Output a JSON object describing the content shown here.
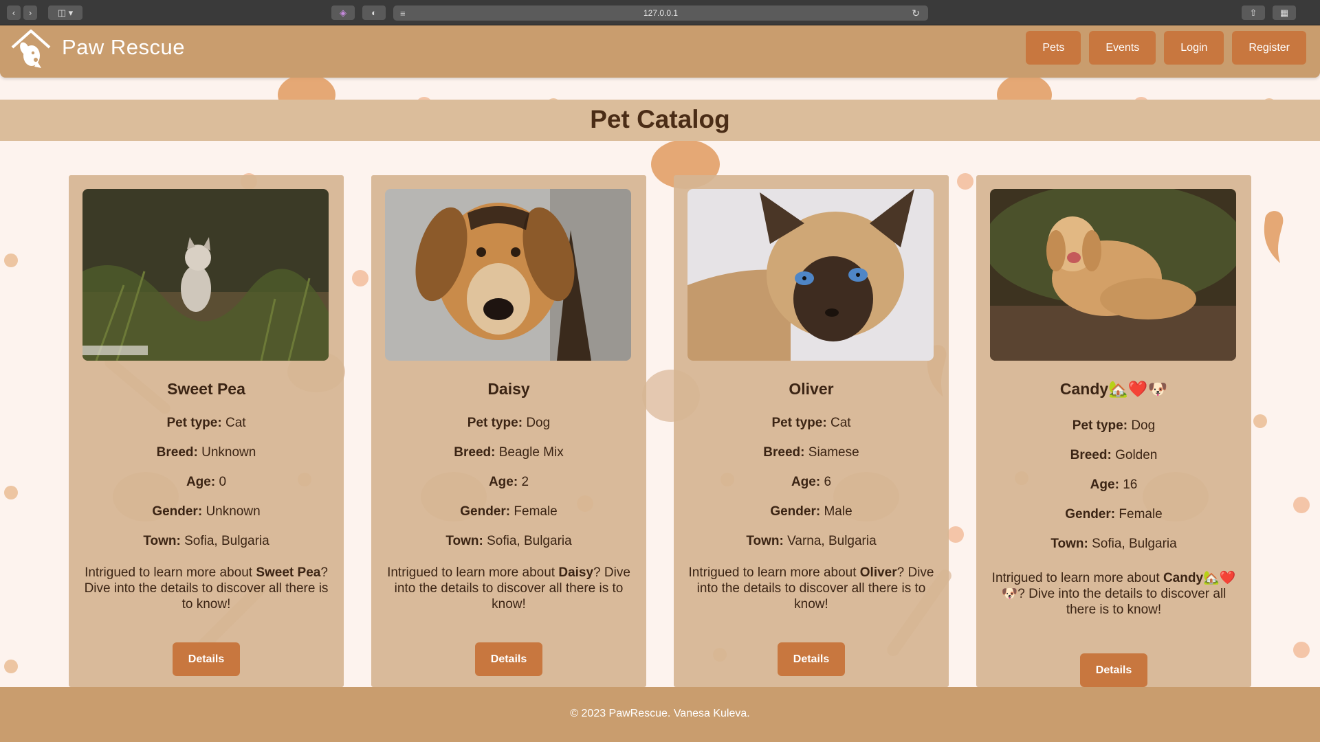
{
  "browser": {
    "url": "127.0.0.1"
  },
  "header": {
    "brand": "Paw Rescue",
    "nav": [
      "Pets",
      "Events",
      "Login",
      "Register"
    ]
  },
  "page": {
    "title": "Pet Catalog"
  },
  "labels": {
    "pet_type": "Pet type:",
    "breed": "Breed:",
    "age": "Age:",
    "gender": "Gender:",
    "town": "Town:",
    "desc_prefix": "Intrigued to learn more about ",
    "desc_suffix": "? Dive into the details to discover all there is to know!",
    "details_button": "Details"
  },
  "pets": [
    {
      "name": "Sweet Pea",
      "pet_type": "Cat",
      "breed": "Unknown",
      "age": "0",
      "gender": "Unknown",
      "town": "Sofia, Bulgaria"
    },
    {
      "name": "Daisy",
      "pet_type": "Dog",
      "breed": "Beagle Mix",
      "age": "2",
      "gender": "Female",
      "town": "Sofia, Bulgaria"
    },
    {
      "name": "Oliver",
      "pet_type": "Cat",
      "breed": "Siamese",
      "age": "6",
      "gender": "Male",
      "town": "Varna, Bulgaria"
    },
    {
      "name": "Candy🏡❤️🐶",
      "pet_type": "Dog",
      "breed": "Golden",
      "age": "16",
      "gender": "Female",
      "town": "Sofia, Bulgaria"
    }
  ],
  "footer": {
    "text": "© 2023 PawRescue. Vanesa Kuleva."
  },
  "colors": {
    "header": "#c99d6e",
    "button": "#c8773f",
    "card": "#d6b592",
    "title_band": "#dbbd9b",
    "background": "#fdf3ee"
  }
}
